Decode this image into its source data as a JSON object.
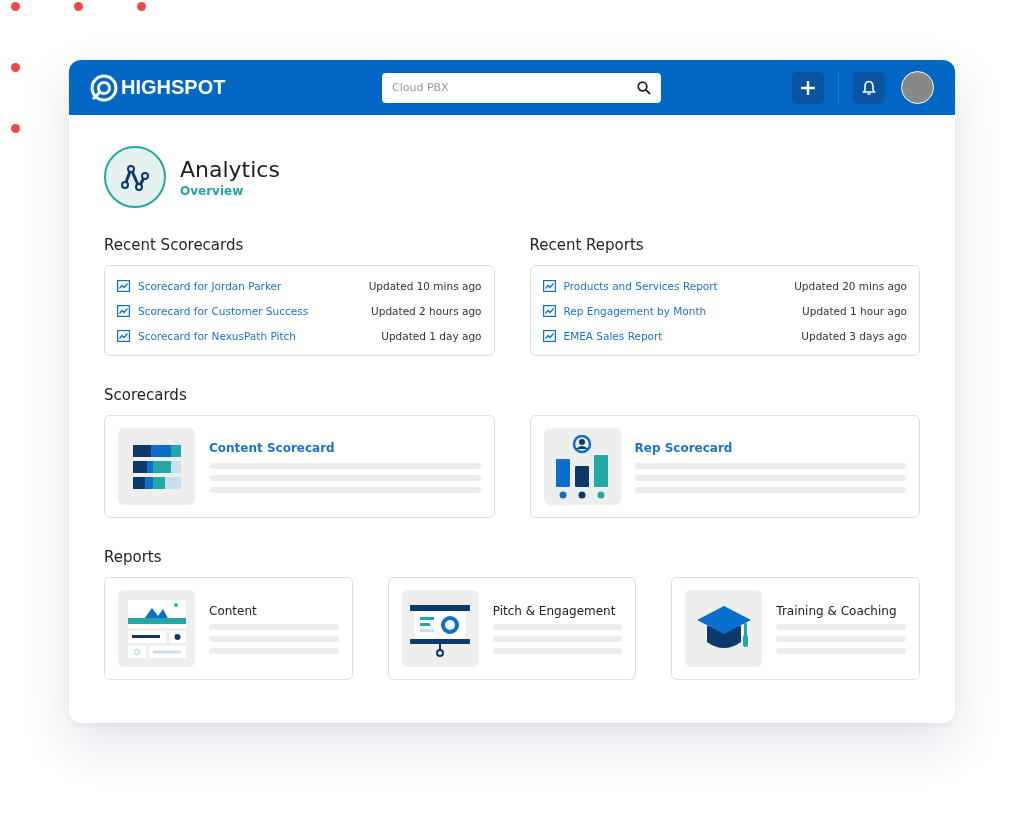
{
  "header": {
    "brand": "HIGHSPOT",
    "search": {
      "value": "Cloud PBX"
    }
  },
  "page": {
    "title": "Analytics",
    "subtitle": "Overview"
  },
  "recent_scorecards": {
    "heading": "Recent Scorecards",
    "items": [
      {
        "title": "Scorecard for Jordan Parker",
        "updated": "Updated 10 mins ago"
      },
      {
        "title": "Scorecard for Customer Success",
        "updated": "Updated 2 hours ago"
      },
      {
        "title": "Scorecard for NexusPath Pitch",
        "updated": "Updated 1 day ago"
      }
    ]
  },
  "recent_reports": {
    "heading": "Recent Reports",
    "items": [
      {
        "title": "Products and Services Report",
        "updated": "Updated 20 mins ago"
      },
      {
        "title": "Rep Engagement by Month",
        "updated": "Updated 1 hour ago"
      },
      {
        "title": "EMEA Sales Report",
        "updated": "Updated 3 days ago"
      }
    ]
  },
  "scorecards": {
    "heading": "Scorecards",
    "cards": [
      {
        "title": "Content Scorecard",
        "kind": "bars"
      },
      {
        "title": "Rep Scorecard",
        "kind": "people"
      }
    ]
  },
  "reports": {
    "heading": "Reports",
    "cards": [
      {
        "title": "Content",
        "kind": "image"
      },
      {
        "title": "Pitch & Engagement",
        "kind": "presentation"
      },
      {
        "title": "Training & Coaching",
        "kind": "graduation"
      }
    ]
  }
}
